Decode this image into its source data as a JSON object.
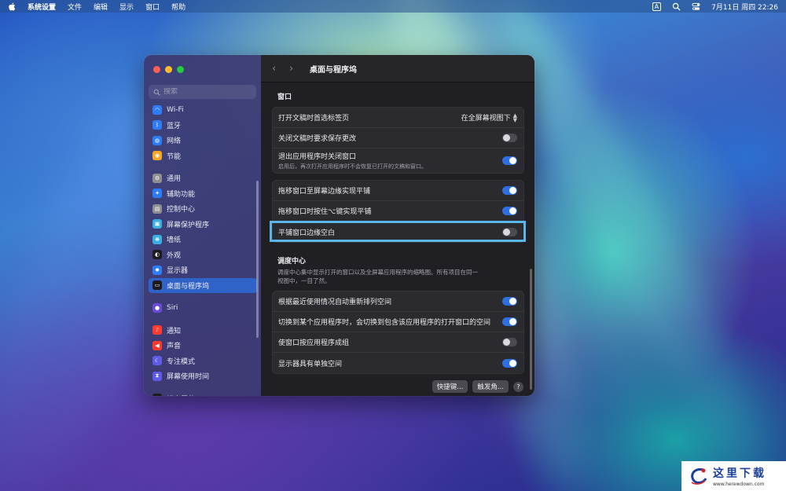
{
  "menubar": {
    "app_name": "系统设置",
    "menus": [
      "文件",
      "编辑",
      "显示",
      "窗口",
      "帮助"
    ],
    "input_method": "A",
    "datetime": "7月11日 周四  22:26"
  },
  "sidebar": {
    "search_placeholder": "搜索",
    "items": [
      {
        "label": "Wi-Fi",
        "icon": "wifi-icon",
        "color": "#2f7df6"
      },
      {
        "label": "蓝牙",
        "icon": "bluetooth-icon",
        "color": "#2f7df6"
      },
      {
        "label": "网络",
        "icon": "globe-icon",
        "color": "#2f7df6"
      },
      {
        "label": "节能",
        "icon": "lightbulb-icon",
        "color": "#f5a623"
      },
      {
        "label": "通用",
        "icon": "gear-icon",
        "color": "#8e8e93"
      },
      {
        "label": "辅助功能",
        "icon": "accessibility-icon",
        "color": "#2f7df6"
      },
      {
        "label": "控制中心",
        "icon": "control-center-icon",
        "color": "#8e8e93"
      },
      {
        "label": "屏幕保护程序",
        "icon": "screensaver-icon",
        "color": "#3ab0e0"
      },
      {
        "label": "墙纸",
        "icon": "wallpaper-icon",
        "color": "#3ab0e0"
      },
      {
        "label": "外观",
        "icon": "appearance-icon",
        "color": "#1c1c1e"
      },
      {
        "label": "显示器",
        "icon": "display-icon",
        "color": "#2f7df6"
      },
      {
        "label": "桌面与程序坞",
        "icon": "dock-icon",
        "color": "#1c1c1e"
      },
      {
        "label": "Siri",
        "icon": "siri-icon",
        "color": "#6a4bd8"
      },
      {
        "label": "通知",
        "icon": "bell-icon",
        "color": "#ff3b30"
      },
      {
        "label": "声音",
        "icon": "speaker-icon",
        "color": "#ff3b30"
      },
      {
        "label": "专注模式",
        "icon": "moon-icon",
        "color": "#5e5ce6"
      },
      {
        "label": "屏幕使用时间",
        "icon": "hourglass-icon",
        "color": "#5e5ce6"
      },
      {
        "label": "锁定屏幕",
        "icon": "lock-icon",
        "color": "#1c1c1e"
      }
    ],
    "active_label": "桌面与程序坞"
  },
  "window": {
    "title": "桌面与程序坞",
    "back_glyph": "‹",
    "forward_glyph": "›"
  },
  "windows_section": {
    "title": "窗口",
    "rows": [
      {
        "label": "打开文稿时首选标签页",
        "select_value": "在全屏幕视图下"
      },
      {
        "label": "关闭文稿时要求保存更改",
        "toggle": false
      },
      {
        "label": "退出应用程序时关闭窗口",
        "sub": "启用后，再次打开应用程序时不会恢复已打开的文稿和窗口。",
        "toggle": true
      }
    ],
    "tiling_rows": [
      {
        "label": "拖移窗口至屏幕边缘实现平铺",
        "toggle": true
      },
      {
        "label": "拖移窗口时按住⌥键实现平铺",
        "toggle": true
      },
      {
        "label": "平铺窗口边缘空白",
        "toggle": false
      }
    ]
  },
  "mission_control": {
    "title": "调度中心",
    "description": "调度中心集中显示打开的窗口以及全屏幕应用程序的缩略图。所有项目在同一视图中，一目了然。",
    "rows": [
      {
        "label": "根据最近使用情况自动重新排列空间",
        "toggle": true
      },
      {
        "label": "切换到某个应用程序时，会切换到包含该应用程序的打开窗口的空间",
        "toggle": true
      },
      {
        "label": "使窗口按应用程序成组",
        "toggle": false
      },
      {
        "label": "显示器具有单独空间",
        "toggle": true
      }
    ]
  },
  "footer": {
    "shortcuts_button": "快捷键...",
    "hot_corners_button": "触发角...",
    "help_label": "?"
  },
  "watermark": {
    "title": "这里下载",
    "url": "www.herewdown.com"
  },
  "colors": {
    "accent": "#2f6fe0",
    "highlight_border": "#58b6ea"
  }
}
